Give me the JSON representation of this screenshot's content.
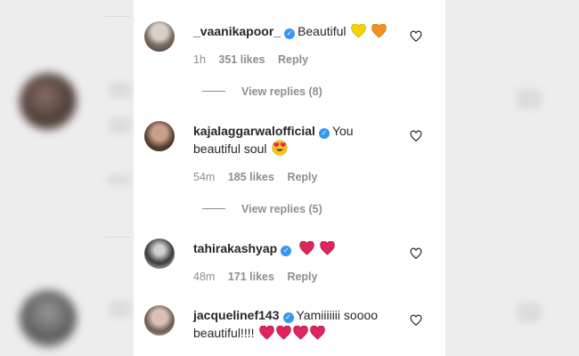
{
  "comments": [
    {
      "username": "_vaanikapoor_",
      "text": "Beautiful",
      "emojis": [
        "yellow-heart",
        "orange-heart"
      ],
      "time": "1h",
      "likes": "351 likes",
      "reply_label": "Reply",
      "view_replies": "View replies (8)"
    },
    {
      "username": "kajalaggarwalofficial",
      "text": "You beautiful soul",
      "emojis": [
        "heart-eyes"
      ],
      "time": "54m",
      "likes": "185 likes",
      "reply_label": "Reply",
      "view_replies": "View replies (5)"
    },
    {
      "username": "tahirakashyap",
      "text": "",
      "emojis": [
        "red-heart",
        "red-heart"
      ],
      "time": "48m",
      "likes": "171 likes",
      "reply_label": "Reply"
    },
    {
      "username": "jacquelinef143",
      "text": "Yamiiiiiii soooo beautiful!!!!",
      "emojis": [
        "red-heart",
        "red-heart",
        "red-heart",
        "red-heart"
      ]
    }
  ],
  "icons": {
    "like": "heart-outline-icon",
    "verified": "verified-badge-icon"
  },
  "colors": {
    "verified": "#3897f0",
    "meta": "#8e8e8e",
    "text": "#262626",
    "red_heart": "#e0245e"
  }
}
